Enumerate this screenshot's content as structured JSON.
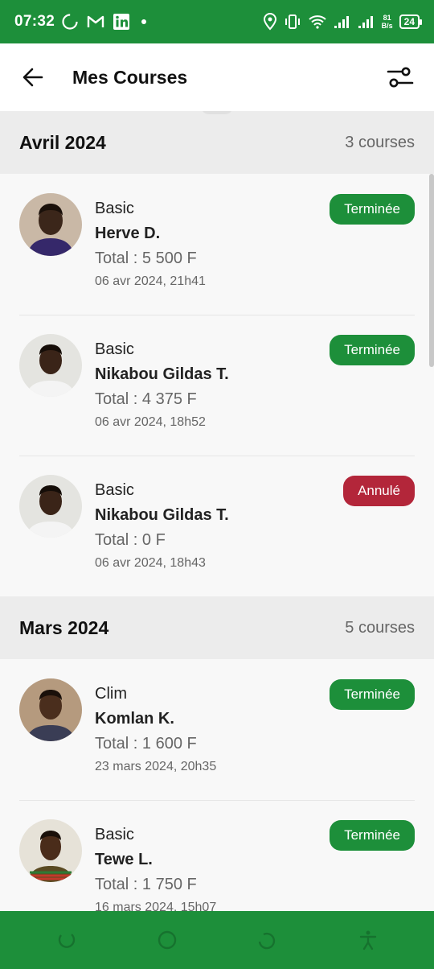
{
  "status_bar": {
    "time": "07:32",
    "net_speed_value": "81",
    "net_speed_unit": "B/s",
    "battery": "24"
  },
  "appbar": {
    "title": "Mes Courses"
  },
  "colors": {
    "brand_green": "#1d8f3a",
    "cancel_red": "#b3263a"
  },
  "sections": [
    {
      "month": "Avril 2024",
      "count": "3 courses",
      "rides": [
        {
          "type": "Basic",
          "name": "Herve D.",
          "total": "Total : 5 500 F",
          "date": "06 avr 2024, 21h41",
          "status": "Terminée"
        },
        {
          "type": "Basic",
          "name": "Nikabou Gildas T.",
          "total": "Total : 4 375 F",
          "date": "06 avr 2024, 18h52",
          "status": "Terminée"
        },
        {
          "type": "Basic",
          "name": "Nikabou Gildas T.",
          "total": "Total : 0 F",
          "date": "06 avr 2024, 18h43",
          "status": "Annulé"
        }
      ]
    },
    {
      "month": "Mars 2024",
      "count": "5 courses",
      "rides": [
        {
          "type": "Clim",
          "name": "Komlan K.",
          "total": "Total : 1 600 F",
          "date": "23 mars 2024, 20h35",
          "status": "Terminée"
        },
        {
          "type": "Basic",
          "name": "Tewe L.",
          "total": "Total : 1 750 F",
          "date": "16 mars 2024, 15h07",
          "status": "Terminée"
        }
      ]
    }
  ]
}
